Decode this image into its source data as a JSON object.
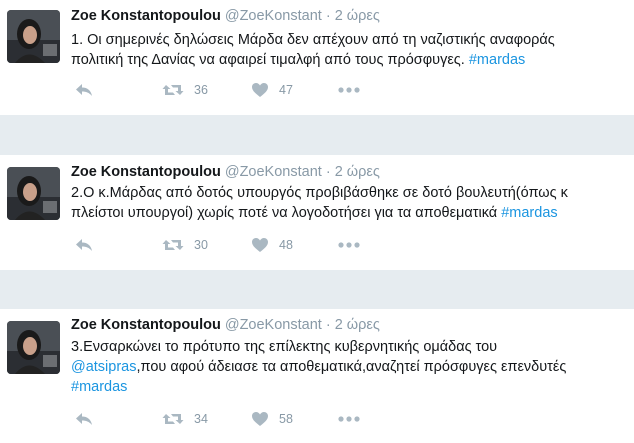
{
  "tweets": [
    {
      "author": {
        "name": "Zoe Konstantopoulou",
        "handle": "@ZoeKonstant"
      },
      "separator": "·",
      "time": "2 ώρες",
      "text_parts": [
        {
          "text": "1. Οι σημερινές δηλώσεις Μάρδα δεν απέχουν από τη ναζιστικής αναφοράς\nπολιτική της Δανίας να αφαιρεί τιμαλφή από τους πρόσφυγες. ",
          "link": false
        },
        {
          "text": "#mardas",
          "link": true
        }
      ],
      "retweets": "36",
      "likes": "47"
    },
    {
      "author": {
        "name": "Zoe Konstantopoulou",
        "handle": "@ZoeKonstant"
      },
      "separator": "·",
      "time": "2 ώρες",
      "text_parts": [
        {
          "text": "2.Ο κ.Μάρδας από δοτός υπουργός προβιβάσθηκε σε δοτό βουλευτή(όπως κ\nπλείστοι υπουργοί) χωρίς ποτέ να λογοδοτήσει για τα αποθεματικά ",
          "link": false
        },
        {
          "text": "#mardas",
          "link": true
        }
      ],
      "retweets": "30",
      "likes": "48"
    },
    {
      "author": {
        "name": "Zoe Konstantopoulou",
        "handle": "@ZoeKonstant"
      },
      "separator": "·",
      "time": "2 ώρες",
      "text_parts": [
        {
          "text": "3.Ενσαρκώνει το πρότυπο της επίλεκτης κυβερνητικής ομάδας του\n",
          "link": false
        },
        {
          "text": "@atsipras",
          "link": true
        },
        {
          "text": ",που αφού άδειασε τα αποθεματικά,αναζητεί πρόσφυγες επενδυτές\n",
          "link": false
        },
        {
          "text": "#mardas",
          "link": true
        }
      ],
      "retweets": "34",
      "likes": "58"
    }
  ],
  "icons": {
    "reply": "reply-icon",
    "retweet": "retweet-icon",
    "like": "heart-icon",
    "more": "more-icon"
  },
  "colors": {
    "name": "#14171a",
    "meta": "#8899a6",
    "link": "#1b95e0",
    "icon": "#aab8c2",
    "background": "#e6ecf0"
  }
}
